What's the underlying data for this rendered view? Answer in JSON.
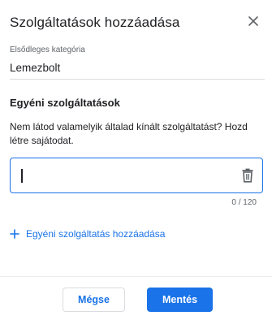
{
  "dialog": {
    "title": "Szolgáltatások hozzáadása",
    "close_icon": "close-icon"
  },
  "primary_category": {
    "label": "Elsődleges kategória",
    "value": "Lemezbolt"
  },
  "custom_services": {
    "heading": "Egyéni szolgáltatások",
    "description": "Nem látod valamelyik általad kínált szolgáltatást? Hozd létre sajátodat.",
    "input_value": "",
    "delete_icon": "trash-icon",
    "char_counter": "0 / 120",
    "add_link_label": "Egyéni szolgáltatás hozzáadása",
    "add_icon": "plus-icon"
  },
  "footer": {
    "cancel_label": "Mégse",
    "save_label": "Mentés"
  },
  "colors": {
    "accent": "#1a73e8",
    "text": "#202124",
    "secondary_text": "#5f6368"
  }
}
